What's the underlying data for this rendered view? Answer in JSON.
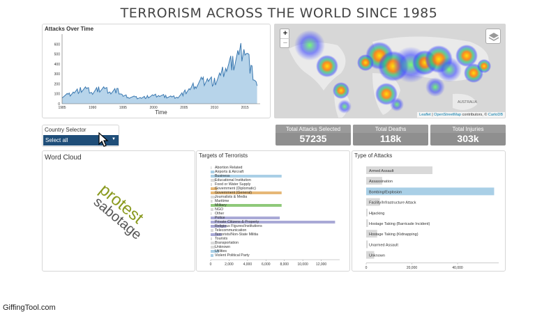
{
  "page": {
    "title": "TERRORISM ACROSS THE WORLD SINCE 1985"
  },
  "timeline": {
    "title": "Attacks Over Time",
    "xlabel": "Time",
    "x_ticks": [
      "1985",
      "1990",
      "1995",
      "2000",
      "2005",
      "2010",
      "2015"
    ],
    "y_ticks": [
      "0",
      "100",
      "200",
      "300",
      "400",
      "500",
      "600"
    ]
  },
  "map": {
    "zoom_in": "+",
    "zoom_out": "−",
    "attribution_leaflet": "Leaflet",
    "attribution_sep": " | ",
    "attribution_osm": "OpenStreetMap",
    "attribution_rest": " contributors, © ",
    "attribution_carto": "CartoDB",
    "label_australia": "AUSTRALIA"
  },
  "country_selector": {
    "label": "Country Selector",
    "value": "Select all",
    "caret": "▼"
  },
  "stats": {
    "attacks_label": "Total Attacks Selected",
    "attacks_value": "57235",
    "deaths_label": "Total Deaths",
    "deaths_value": "118k",
    "injuries_label": "Total Injuries",
    "injuries_value": "303k"
  },
  "wordcloud": {
    "title": "Word Cloud",
    "words": [
      {
        "text": "protest",
        "color": "#8a9a1f"
      },
      {
        "text": "sabotage",
        "color": "#555555"
      }
    ]
  },
  "watermark": "GiffingTool.com",
  "colors": {
    "line": "#3a78b0",
    "area": "#b7d4ea",
    "bar_gray": "#d9d9d9",
    "bar_blue": "#a9cfe6",
    "bar_green": "#8fc97a",
    "bar_orange": "#e6b877",
    "bar_purple": "#a9a9d6",
    "select_bg": "#1f4e79"
  },
  "chart_data": [
    {
      "type": "area",
      "title": "Attacks Over Time",
      "xlabel": "Time",
      "ylabel": "",
      "xlim": [
        1985,
        2017.5
      ],
      "ylim": [
        0,
        700
      ],
      "x": [
        1985,
        1986,
        1987,
        1988,
        1989,
        1990,
        1991,
        1992,
        1993,
        1994,
        1995,
        1996,
        1997,
        1998,
        1999,
        2000,
        2001,
        2002,
        2003,
        2004,
        2005,
        2006,
        2007,
        2008,
        2009,
        2010,
        2011,
        2012,
        2013,
        2014,
        2015,
        2016,
        2017
      ],
      "values": [
        75,
        90,
        120,
        140,
        150,
        110,
        150,
        155,
        120,
        140,
        80,
        70,
        65,
        60,
        70,
        80,
        85,
        75,
        70,
        70,
        110,
        150,
        200,
        230,
        250,
        220,
        280,
        380,
        420,
        500,
        600,
        350,
        180
      ]
    },
    {
      "type": "bar",
      "title": "Targets of Terrorists",
      "orientation": "horizontal",
      "xlim": [
        0,
        14000
      ],
      "x_ticks": [
        "0",
        "2,000",
        "4,000",
        "6,000",
        "8,000",
        "10,000",
        "12,000"
      ],
      "categories": [
        "Abortion Related",
        "Airports & Aircraft",
        "Business",
        "Educational Institution",
        "Food or Water Supply",
        "Government (Diplomatic)",
        "Government (General)",
        "Journalists & Media",
        "Maritime",
        "Military",
        "NGO",
        "Other",
        "Police",
        "Private Citizens & Property",
        "Religious Figures/Institutions",
        "Telecommunication",
        "Terrorists/Non-State Militia",
        "Tourists",
        "Transportation",
        "Unknown",
        "Utilities",
        "Violent Political Party"
      ],
      "values": [
        100,
        400,
        7700,
        500,
        150,
        700,
        7700,
        550,
        200,
        7700,
        300,
        100,
        7500,
        13500,
        1700,
        300,
        1200,
        150,
        700,
        500,
        900,
        300
      ],
      "colors": [
        "#d9d9d9",
        "#a9cfe6",
        "#a9cfe6",
        "#d9d9d9",
        "#d9d9d9",
        "#e6b877",
        "#e6b877",
        "#d9d9d9",
        "#d9d9d9",
        "#8fc97a",
        "#d9d9d9",
        "#d9d9d9",
        "#a9a9d6",
        "#a9a9d6",
        "#a9a9d6",
        "#d9d9d9",
        "#a9a9d6",
        "#d9d9d9",
        "#d9d9d9",
        "#d9d9d9",
        "#a9cfe6",
        "#a9cfe6"
      ]
    },
    {
      "type": "bar",
      "title": "Type of Attacks",
      "orientation": "horizontal",
      "xlim": [
        0,
        58000
      ],
      "x_ticks": [
        "0",
        "20,000",
        "40,000"
      ],
      "categories": [
        "Armed Assault",
        "Assassination",
        "Bombing/Explosion",
        "Facility/Infrastructure Attack",
        "Hijacking",
        "Hostage Taking (Barricade Incident)",
        "Hostage Taking (Kidnapping)",
        "Unarmed Assault",
        "Unknown"
      ],
      "values": [
        29000,
        7000,
        56000,
        6000,
        600,
        800,
        4800,
        700,
        3500
      ],
      "colors": [
        "#d9d9d9",
        "#d9d9d9",
        "#a9cfe6",
        "#d9d9d9",
        "#d9d9d9",
        "#d9d9d9",
        "#d9d9d9",
        "#d9d9d9",
        "#d9d9d9"
      ]
    }
  ]
}
